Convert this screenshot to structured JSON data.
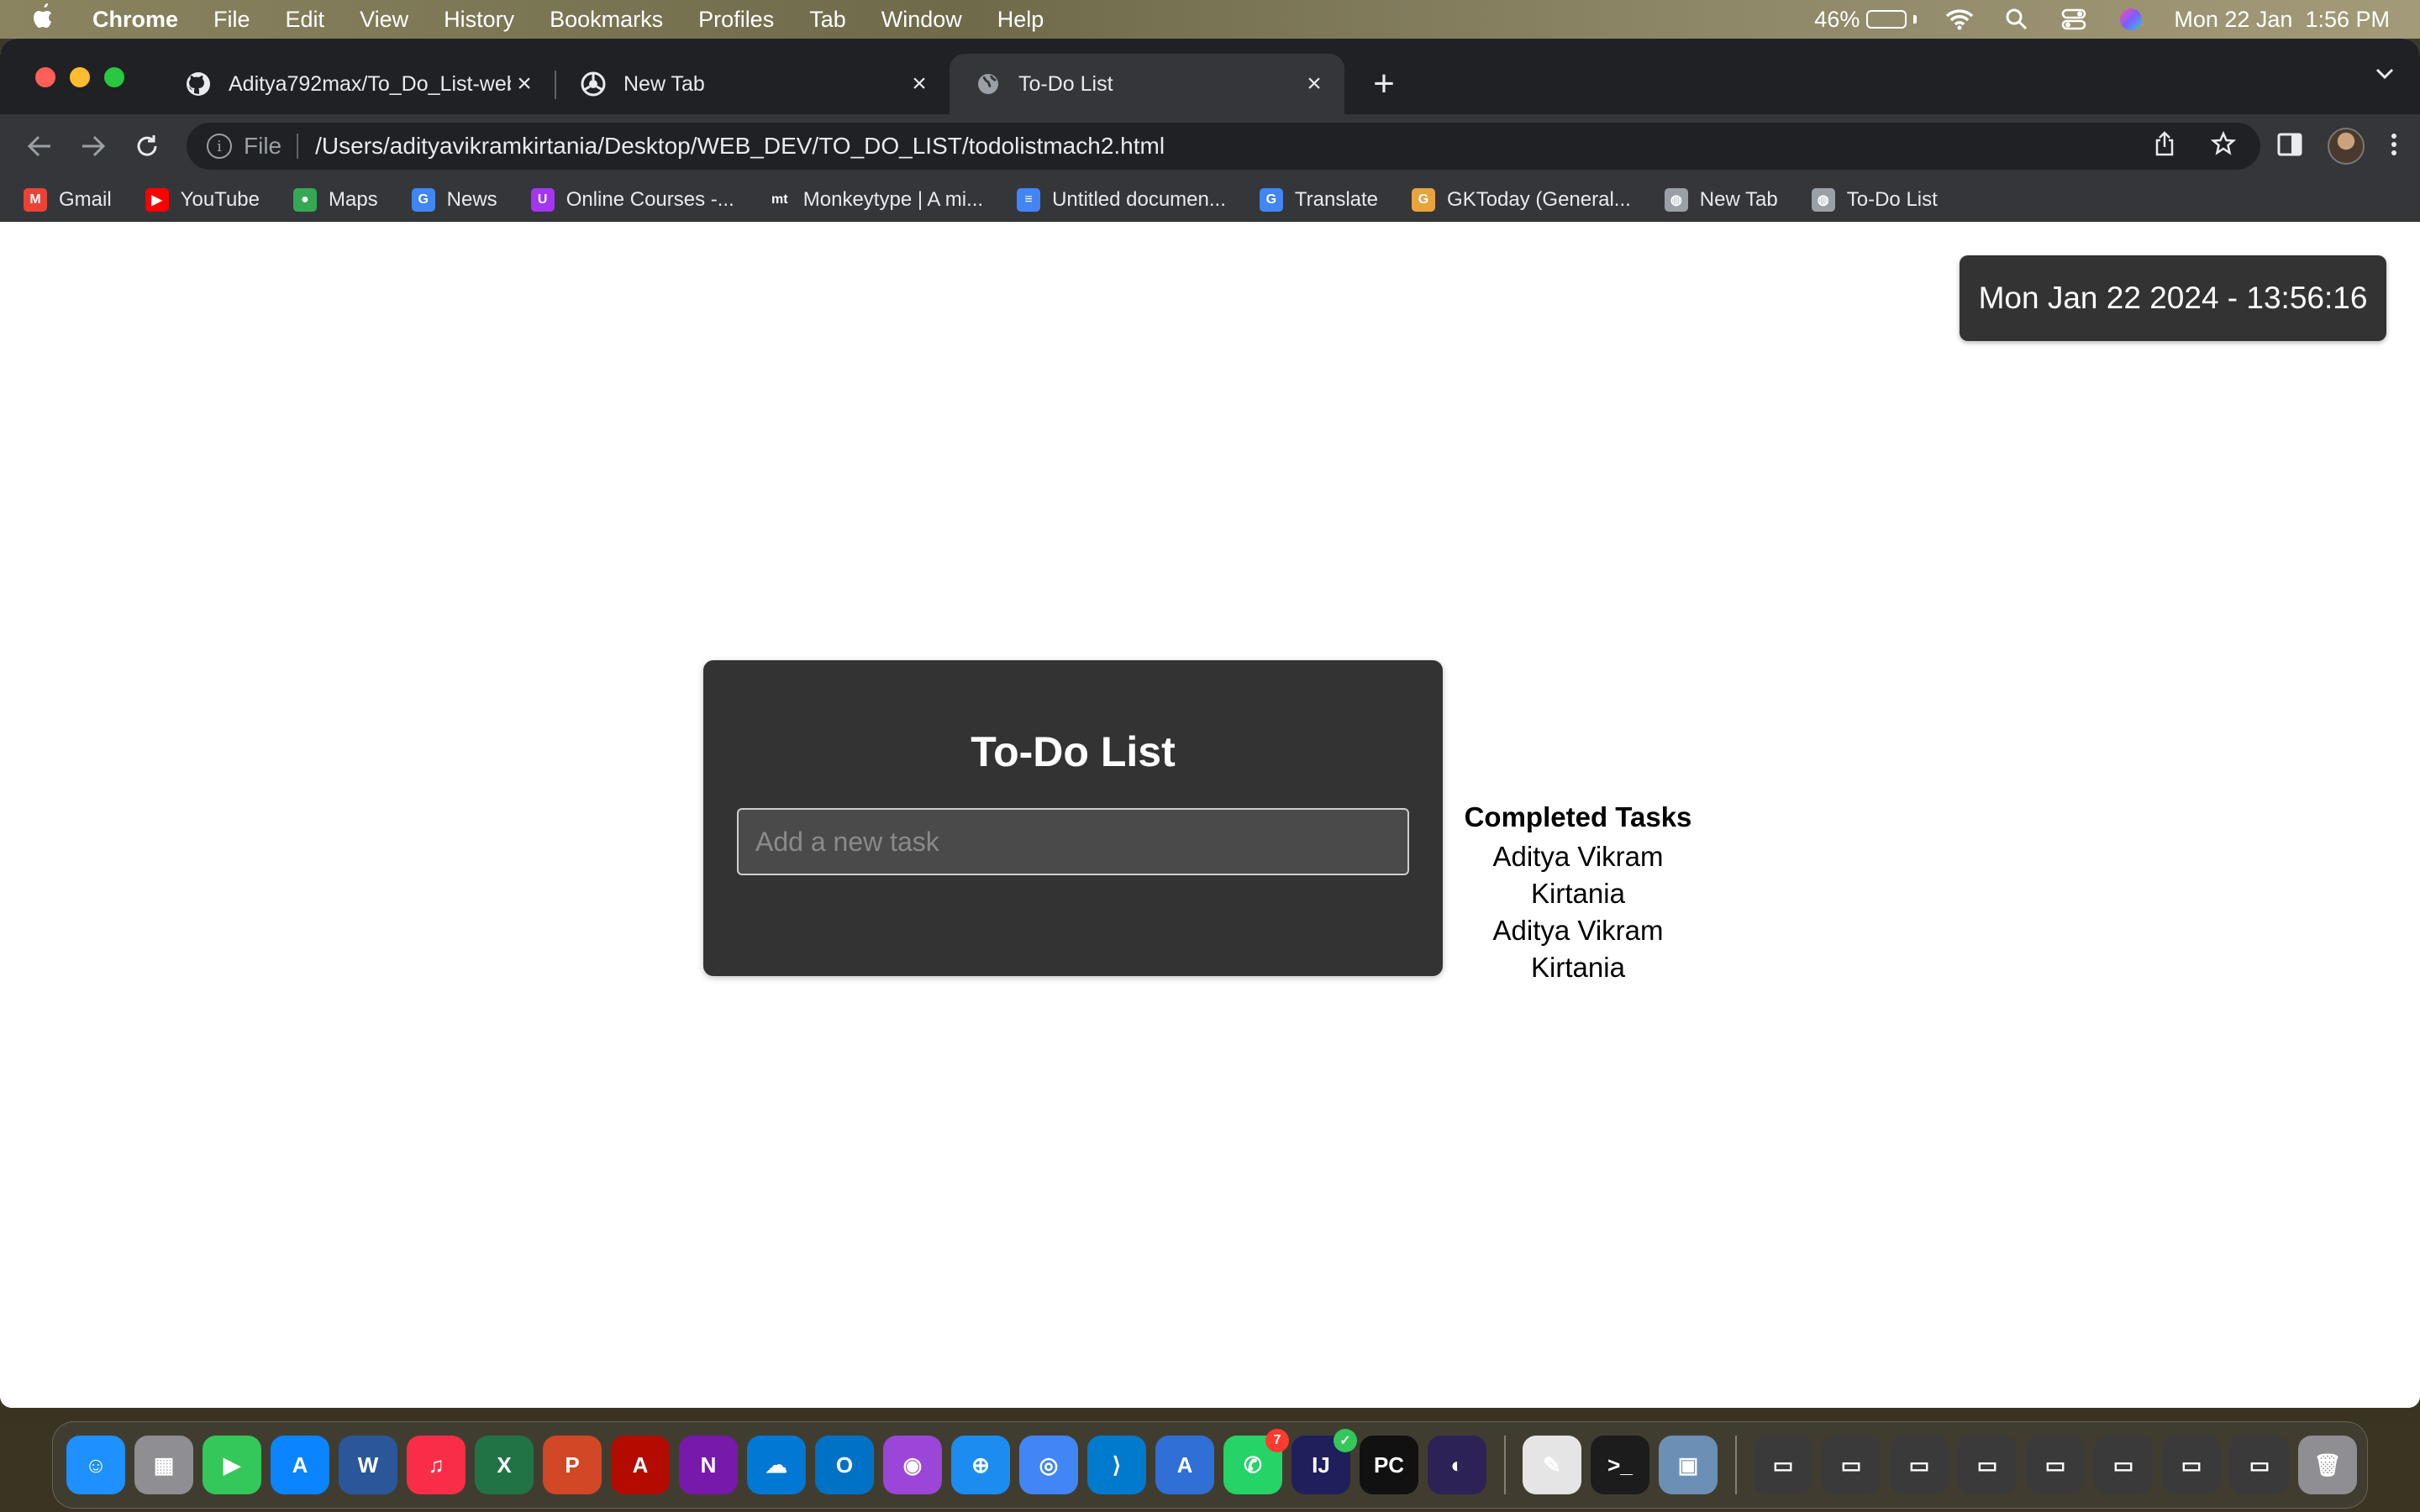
{
  "menubar": {
    "app_name": "Chrome",
    "menus": [
      "File",
      "Edit",
      "View",
      "History",
      "Bookmarks",
      "Profiles",
      "Tab",
      "Window",
      "Help"
    ],
    "battery_percent": "46%",
    "battery_level": 0.46,
    "datetime": "Mon 22 Jan  1:56 PM"
  },
  "tabs": [
    {
      "title": "Aditya792max/To_Do_List-web",
      "icon": "github-icon"
    },
    {
      "title": "New Tab",
      "icon": "chrome-icon"
    },
    {
      "title": "To-Do List",
      "icon": "globe-icon",
      "active": true
    }
  ],
  "toolbar": {
    "scheme_label": "File",
    "url": "/Users/adityavikramkirtania/Desktop/WEB_DEV/TO_DO_LIST/todolistmach2.html"
  },
  "bookmarks": [
    {
      "label": "Gmail",
      "icon": "gmail-icon",
      "color": "#ea4335",
      "glyph": "M"
    },
    {
      "label": "YouTube",
      "icon": "youtube-icon",
      "color": "#ff0000",
      "glyph": "▶"
    },
    {
      "label": "Maps",
      "icon": "maps-icon",
      "color": "#34a853",
      "glyph": "●"
    },
    {
      "label": "News",
      "icon": "news-icon",
      "color": "#4285f4",
      "glyph": "G"
    },
    {
      "label": "Online Courses -...",
      "icon": "udemy-icon",
      "color": "#a435f0",
      "glyph": "U"
    },
    {
      "label": "Monkeytype | A mi...",
      "icon": "monkeytype-icon",
      "color": "#35363a",
      "glyph": "mt"
    },
    {
      "label": "Untitled documen...",
      "icon": "docs-icon",
      "color": "#4285f4",
      "glyph": "≡"
    },
    {
      "label": "Translate",
      "icon": "translate-icon",
      "color": "#4285f4",
      "glyph": "G"
    },
    {
      "label": "GKToday (General...",
      "icon": "gktoday-icon",
      "color": "#e8a33d",
      "glyph": "G"
    },
    {
      "label": "New Tab",
      "icon": "globe-icon",
      "color": "#9aa0a6",
      "glyph": "◍"
    },
    {
      "label": "To-Do List",
      "icon": "globe-icon",
      "color": "#9aa0a6",
      "glyph": "◍"
    }
  ],
  "page": {
    "clock": "Mon Jan 22 2024 - 13:56:16",
    "todo_title": "To-Do List",
    "input_placeholder": "Add a new task",
    "input_value": "",
    "completed_heading": "Completed Tasks",
    "completed_tasks": [
      "Aditya Vikram Kirtania",
      "Aditya Vikram Kirtania"
    ]
  },
  "dock": {
    "apps": [
      {
        "name": "finder-icon",
        "color": "#1e90ff",
        "glyph": "☺"
      },
      {
        "name": "launchpad-icon",
        "color": "#8e8e93",
        "glyph": "▦"
      },
      {
        "name": "facetime-icon",
        "color": "#34c759",
        "glyph": "▶"
      },
      {
        "name": "app-store-icon",
        "color": "#0a84ff",
        "glyph": "A"
      },
      {
        "name": "word-icon",
        "color": "#2b579a",
        "glyph": "W"
      },
      {
        "name": "music-icon",
        "color": "#fa2d48",
        "glyph": "♫"
      },
      {
        "name": "excel-icon",
        "color": "#217346",
        "glyph": "X"
      },
      {
        "name": "powerpoint-icon",
        "color": "#d24726",
        "glyph": "P"
      },
      {
        "name": "acrobat-icon",
        "color": "#b30b00",
        "glyph": "A"
      },
      {
        "name": "onenote-icon",
        "color": "#7719aa",
        "glyph": "N"
      },
      {
        "name": "onedrive-icon",
        "color": "#0078d4",
        "glyph": "☁"
      },
      {
        "name": "outlook-icon",
        "color": "#0072c6",
        "glyph": "O"
      },
      {
        "name": "podcasts-icon",
        "color": "#9b45d9",
        "glyph": "◉"
      },
      {
        "name": "safari-icon",
        "color": "#1c8cf0",
        "glyph": "⊕"
      },
      {
        "name": "chrome-icon",
        "color": "#4285f4",
        "glyph": "◎"
      },
      {
        "name": "vscode-icon",
        "color": "#007acc",
        "glyph": "⟩"
      },
      {
        "name": "xcode-instruments-icon",
        "color": "#2f6fd6",
        "glyph": "A"
      },
      {
        "name": "whatsapp-icon",
        "color": "#25d366",
        "glyph": "✆",
        "badge": "7"
      },
      {
        "name": "intellij-icon",
        "color": "#1f1f5c",
        "glyph": "IJ",
        "badge_green": true
      },
      {
        "name": "pycharm-icon",
        "color": "#111111",
        "glyph": "PC"
      },
      {
        "name": "eclipse-icon",
        "color": "#2c2255",
        "glyph": "◐"
      }
    ],
    "utilities": [
      {
        "name": "textedit-icon",
        "color": "#e5e5e5",
        "glyph": "✎"
      },
      {
        "name": "terminal-icon",
        "color": "#1c1c1c",
        "glyph": ">_"
      },
      {
        "name": "preview-icon",
        "color": "#6b8fb5",
        "glyph": "▣"
      }
    ],
    "minimized": [
      {
        "name": "minimized-window-icon",
        "color": "#3a3a3a",
        "glyph": "▭"
      },
      {
        "name": "minimized-window-icon",
        "color": "#3a3a3a",
        "glyph": "▭"
      },
      {
        "name": "minimized-window-icon",
        "color": "#3a3a3a",
        "glyph": "▭"
      },
      {
        "name": "minimized-window-icon",
        "color": "#3a3a3a",
        "glyph": "▭"
      },
      {
        "name": "minimized-window-icon",
        "color": "#3a3a3a",
        "glyph": "▭"
      },
      {
        "name": "minimized-window-icon",
        "color": "#3a3a3a",
        "glyph": "▭"
      },
      {
        "name": "minimized-window-icon",
        "color": "#3a3a3a",
        "glyph": "▭"
      },
      {
        "name": "minimized-window-icon",
        "color": "#3a3a3a",
        "glyph": "▭"
      },
      {
        "name": "trash-icon",
        "color": "#8e8e93",
        "glyph": "🗑"
      }
    ]
  }
}
